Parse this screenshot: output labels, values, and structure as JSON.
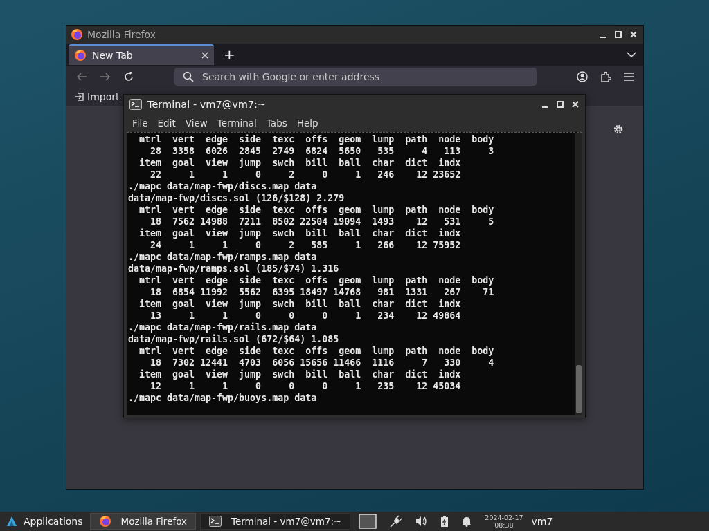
{
  "firefox": {
    "title": "Mozilla Firefox",
    "tabs": [
      {
        "label": "New Tab",
        "selected": true
      }
    ],
    "new_tab": "+",
    "search": {
      "placeholder": "Search with Google or enter address"
    },
    "bookmarks": [
      "Import"
    ]
  },
  "terminal": {
    "title": "Terminal - vm7@vm7:~",
    "menu": [
      "File",
      "Edit",
      "View",
      "Terminal",
      "Tabs",
      "Help"
    ],
    "lines": [
      "  mtrl  vert  edge  side  texc  offs  geom  lump  path  node  body",
      "    28  3358  6026  2845  2749  6824  5650   535     4   113     3",
      "  item  goal  view  jump  swch  bill  ball  char  dict  indx",
      "    22     1     1     0     2     0     1   246    12 23652",
      "./mapc data/map-fwp/discs.map data",
      "data/map-fwp/discs.sol (126/$128) 2.279",
      "  mtrl  vert  edge  side  texc  offs  geom  lump  path  node  body",
      "    18  7562 14988  7211  8502 22504 19094  1493    12   531     5",
      "  item  goal  view  jump  swch  bill  ball  char  dict  indx",
      "    24     1     1     0     2   585     1   266    12 75952",
      "./mapc data/map-fwp/ramps.map data",
      "data/map-fwp/ramps.sol (185/$74) 1.316",
      "  mtrl  vert  edge  side  texc  offs  geom  lump  path  node  body",
      "    18  6854 11992  5562  6395 18497 14768   981  1331   267    71",
      "  item  goal  view  jump  swch  bill  ball  char  dict  indx",
      "    13     1     1     0     0     0     1   234    12 49864",
      "./mapc data/map-fwp/rails.map data",
      "data/map-fwp/rails.sol (672/$64) 1.085",
      "  mtrl  vert  edge  side  texc  offs  geom  lump  path  node  body",
      "    18  7302 12441  4703  6056 15656 11466  1116     7   330     4",
      "  item  goal  view  jump  swch  bill  ball  char  dict  indx",
      "    12     1     1     0     0     0     1   235    12 45034",
      "./mapc data/map-fwp/buoys.map data"
    ]
  },
  "taskbar": {
    "applications": "Applications",
    "tasks": [
      {
        "label": "Mozilla Firefox",
        "kind": "firefox",
        "selected": false
      },
      {
        "label": "Terminal - vm7@vm7:~",
        "kind": "terminal",
        "selected": true
      }
    ],
    "date": "2024-02-17",
    "time": "08:38",
    "user": "vm7"
  }
}
